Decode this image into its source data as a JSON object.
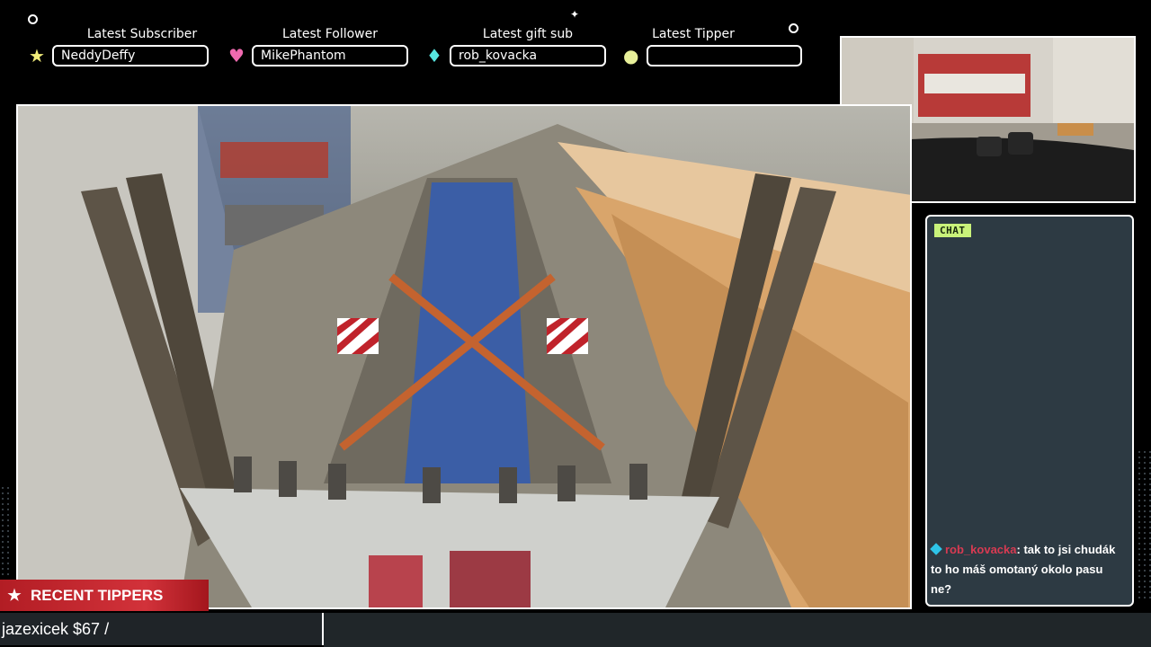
{
  "alerts": [
    {
      "label": "Latest Subscriber",
      "value": "NeddyDeffy",
      "icon": "star-icon",
      "color": "#f2ed7a"
    },
    {
      "label": "Latest Follower",
      "value": "MikePhantom",
      "icon": "heart-icon",
      "color": "#f06ab0"
    },
    {
      "label": "Latest gift sub",
      "value": "rob_kovacka",
      "icon": "diamond-icon",
      "color": "#57e6e0"
    },
    {
      "label": "Latest Tipper",
      "value": "",
      "icon": "coin-icon",
      "color": "#e8f09a"
    }
  ],
  "chat": {
    "badge": "CHAT",
    "messages": [
      {
        "user": "rob_kovacka",
        "text": ": tak to jsi chudák to ho máš omotaný okolo pasu ne?"
      }
    ]
  },
  "tippers": {
    "heading": "RECENT TIPPERS",
    "ticker": "jazexicek $67 /"
  },
  "colors": {
    "background": "#000000",
    "chat_bg": "#2d3a43",
    "tippers_red": "#c4262e",
    "chat_badge": "#c9f27a"
  }
}
